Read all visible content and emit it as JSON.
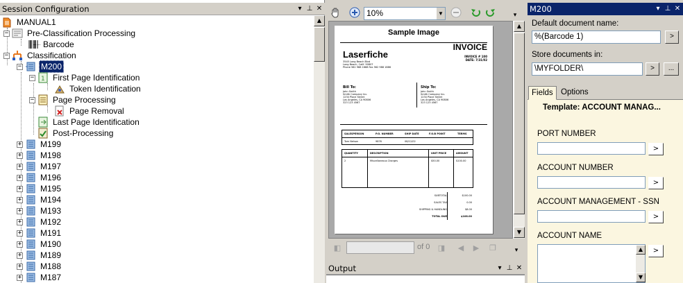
{
  "session": {
    "title": "Session Configuration",
    "tree": {
      "root": "MANUAL1",
      "pre_classification": "Pre-Classification Processing",
      "barcode": "Barcode",
      "classification": "Classification",
      "selected": "M200",
      "first_page": "First Page Identification",
      "token": "Token Identification",
      "page_processing": "Page Processing",
      "page_removal": "Page Removal",
      "last_page": "Last Page Identification",
      "post_processing": "Post-Processing",
      "items": [
        "M199",
        "M198",
        "M197",
        "M196",
        "M195",
        "M194",
        "M193",
        "M192",
        "M191",
        "M190",
        "M189",
        "M188",
        "M187"
      ]
    }
  },
  "viewer": {
    "zoom": "10%",
    "page_of": "of 0",
    "doc": {
      "header": "Sample Image",
      "company": "Laserfiche",
      "company_addr1": "3545 Long Beach Blvd",
      "company_addr2": "Long Beach, Calif. 90807",
      "company_phone": "Phone 562 988 1688    Fax 562 988 1886",
      "invoice_title": "INVOICE",
      "invoice_no": "INVOICE # 100",
      "invoice_date": "DATE: 7/31/02",
      "bill_to": "Bill To:",
      "bill_lines": [
        "John Smith",
        "Smith Company Inc.",
        "1234 Place Street",
        "Los Angeles, CA 90806",
        "323 123 4567"
      ],
      "ship_to": "Ship To:",
      "ship_lines": [
        "John Smith",
        "Smith Company Inc.",
        "1234 Place Street",
        "Los Angeles, CA 90806",
        "323 123 4567"
      ],
      "t1_headers": [
        "SALESPERSON",
        "P.O. NUMBER",
        "SHIP DATE",
        "F.O.B POINT",
        "TERMS"
      ],
      "t1_row": [
        "Tom Nelson",
        "9876",
        "08/12/02",
        "",
        ""
      ],
      "t2_headers": [
        "QUANTITY",
        "DESCRIPTION",
        "UNIT PRICE",
        "AMOUNT"
      ],
      "t2_row": [
        "2",
        "Miscellaneous Charges",
        "$50.00",
        "$100.00"
      ],
      "totals_labels": [
        "SUBTOTAL",
        "SALES TAX",
        "SHIPPING & HANDLING",
        "TOTAL DUE"
      ],
      "totals_values": [
        "$100.00",
        "0.00",
        "$8.00",
        "$108.00"
      ]
    }
  },
  "output": {
    "title": "Output"
  },
  "properties": {
    "title": "M200",
    "default_name_label": "Default document name:",
    "default_name_value": "%(Barcode 1)",
    "store_label": "Store documents in:",
    "store_value": "\\MYFOLDER\\",
    "browse_btn": ">",
    "ellipsis_btn": "...",
    "tabs": [
      "Fields",
      "Options"
    ],
    "template": "Template: ACCOUNT MANAG...",
    "fields": [
      "PORT NUMBER",
      "ACCOUNT NUMBER",
      "ACCOUNT MANAGEMENT - SSN",
      "ACCOUNT NAME"
    ]
  }
}
